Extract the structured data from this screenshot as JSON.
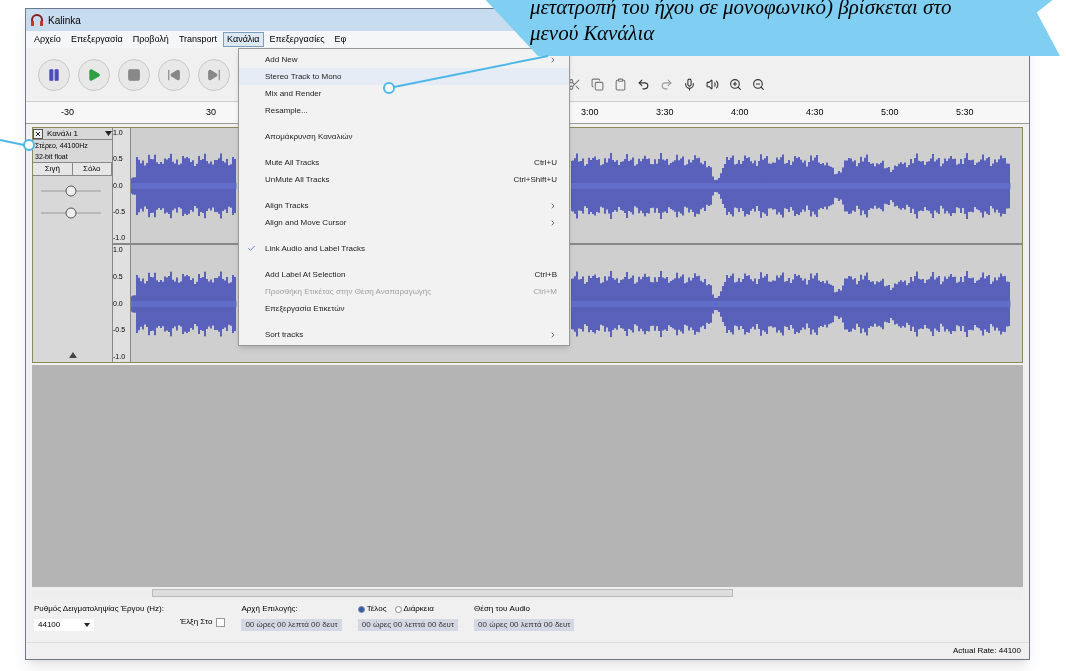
{
  "window": {
    "title": "Kalinka"
  },
  "menu_bar": [
    {
      "label": "Αρχείο",
      "selected": false
    },
    {
      "label": "Επεξεργασία",
      "selected": false
    },
    {
      "label": "Προβολή",
      "selected": false
    },
    {
      "label": "Transport",
      "selected": false
    },
    {
      "label": "Κανάλια",
      "selected": true
    },
    {
      "label": "Επεξεργασίες",
      "selected": false
    },
    {
      "label": "Εφ",
      "selected": false
    }
  ],
  "ruler": [
    "-30",
    "30",
    "3:00",
    "3:30",
    "4:00",
    "4:30",
    "5:00",
    "5:30"
  ],
  "track": {
    "name": "Κανάλι 1",
    "info": [
      "Στέρεο, 44100Hz",
      "32-bit float"
    ],
    "buttons": [
      "Σιγή",
      "Σόλο"
    ],
    "channels": [
      {
        "axis": [
          "1.0",
          "0.5",
          "0.0",
          "-0.5",
          "-1.0"
        ]
      },
      {
        "axis": [
          "1.0",
          "0.5",
          "0.0",
          "-0.5",
          "-1.0"
        ]
      }
    ]
  },
  "dropdown": [
    {
      "kind": "item",
      "label": "Add New",
      "submenu": true,
      "checked": false,
      "disabled": false,
      "selected": false
    },
    {
      "kind": "item",
      "label": "Stereo Track to Mono",
      "submenu": false,
      "checked": false,
      "disabled": false,
      "selected": true
    },
    {
      "kind": "item",
      "label": "Mix and Render",
      "submenu": false,
      "checked": false,
      "disabled": false,
      "selected": false
    },
    {
      "kind": "item",
      "label": "Resample...",
      "submenu": false,
      "checked": false,
      "disabled": false,
      "selected": false
    },
    {
      "kind": "separator"
    },
    {
      "kind": "item",
      "label": "Απομάκρυνση Καναλιών",
      "submenu": false,
      "checked": false,
      "disabled": false,
      "selected": false
    },
    {
      "kind": "separator"
    },
    {
      "kind": "item",
      "label": "Mute All Tracks",
      "shortcut": "Ctrl+U",
      "submenu": false,
      "checked": false,
      "disabled": false,
      "selected": false
    },
    {
      "kind": "item",
      "label": "UnMute All Tracks",
      "shortcut": "Ctrl+Shift+U",
      "submenu": false,
      "checked": false,
      "disabled": false,
      "selected": false
    },
    {
      "kind": "separator"
    },
    {
      "kind": "item",
      "label": "Align Tracks",
      "submenu": true,
      "checked": false,
      "disabled": false,
      "selected": false
    },
    {
      "kind": "item",
      "label": "Align and Move Cursor",
      "submenu": true,
      "checked": false,
      "disabled": false,
      "selected": false
    },
    {
      "kind": "separator"
    },
    {
      "kind": "item",
      "label": "Link Audio and Label Tracks",
      "submenu": false,
      "checked": true,
      "disabled": false,
      "selected": false
    },
    {
      "kind": "separator"
    },
    {
      "kind": "item",
      "label": "Add Label At Selection",
      "shortcut": "Ctrl+B",
      "submenu": false,
      "checked": false,
      "disabled": false,
      "selected": false
    },
    {
      "kind": "item",
      "label": "Προσθήκη Ετικέτας στην Θέση Αναπαραγωγής",
      "shortcut": "Ctrl+M",
      "submenu": false,
      "checked": false,
      "disabled": true,
      "selected": false
    },
    {
      "kind": "item",
      "label": "Επεξεργασία Ετικετών",
      "submenu": false,
      "checked": false,
      "disabled": false,
      "selected": false
    },
    {
      "kind": "separator"
    },
    {
      "kind": "item",
      "label": "Sort tracks",
      "submenu": true,
      "checked": false,
      "disabled": false,
      "selected": false
    }
  ],
  "selection_bar": {
    "rate_label": "Ρυθμός Δειγματοληψίας Έργου (Hz):",
    "rate_value": "44100",
    "snap_label": "Έλξη Στο",
    "snap_checked": false,
    "start_label": "Αρχή Επιλογής:",
    "start_value": "00 ώρες 00 λεπτά 00 δευτ",
    "end_options": [
      {
        "label": "Τέλος",
        "selected": true
      },
      {
        "label": "Διάρκεια",
        "selected": false
      }
    ],
    "end_value": "00 ώρες 00 λεπτά 00 δευτ",
    "position_label": "Θέση του Audio",
    "position_value": "00 ώρες 00 λεπτά 00 δευτ"
  },
  "status_bar": "Actual Rate: 44100",
  "callout": [
    "μετατροπή του ήχου σε μονοφωνικό) βρίσκεται στο",
    "μενού Κανάλια"
  ]
}
